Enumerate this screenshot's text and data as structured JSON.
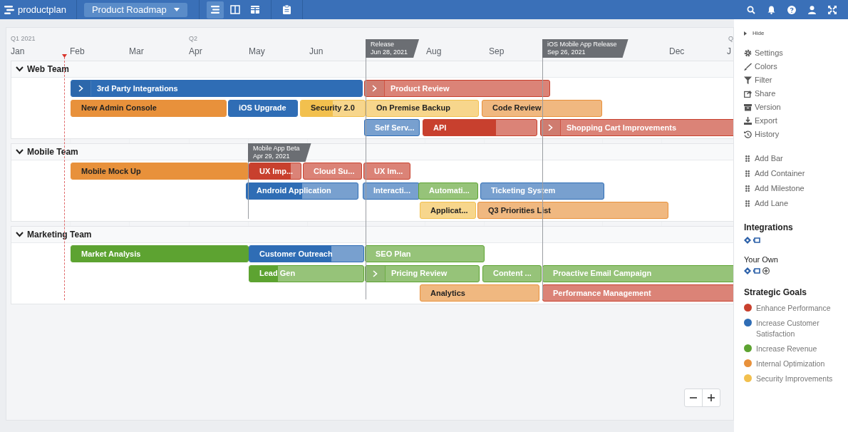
{
  "app": {
    "brand": "productplan",
    "roadmap": "Product Roadmap",
    "views": [
      {
        "kind": "list",
        "selected": true
      },
      {
        "kind": "columns",
        "selected": false
      },
      {
        "kind": "table",
        "selected": false
      }
    ]
  },
  "timeline": {
    "quarters": [
      "Q1 2021",
      "Q2",
      "Q"
    ],
    "months": [
      "Jan",
      "Feb",
      "Mar",
      "Apr",
      "May",
      "Jun",
      "Aug",
      "Sep",
      "Dec",
      "J"
    ],
    "milestones": [
      {
        "title": "Release",
        "date": "Jun 28, 2021"
      },
      {
        "title": "iOS Mobile App Release",
        "date": "Sep 26, 2021"
      },
      {
        "title": "Mobile App Beta",
        "date": "Apr 29, 2021"
      }
    ],
    "lanes": [
      {
        "name": "Web Team",
        "expanded": true,
        "rows": [
          {
            "bars": [
              {
                "label": "3rd Party Integrations",
                "kind": "container",
                "color": "#2f6db5",
                "level": 1
              },
              {
                "label": "Product Review",
                "kind": "container",
                "color": "#c8402e",
                "level": 0
              }
            ]
          },
          {
            "bars": [
              {
                "label": "New Admin Console",
                "kind": "bar",
                "color": "#e8913b",
                "level": 1
              },
              {
                "label": "iOS Upgrade",
                "kind": "bar",
                "color": "#2f6db5",
                "level": 1
              },
              {
                "label": "Security 2.0",
                "kind": "bar",
                "color": "#f2c04e",
                "level": 0.5
              },
              {
                "label": "On Premise Backup",
                "kind": "bar",
                "color": "#f2c04e",
                "level": 0
              },
              {
                "label": "Code Review",
                "kind": "bar",
                "color": "#e8913b",
                "level": 0
              }
            ]
          },
          {
            "bars": [
              {
                "label": "Self Serv...",
                "kind": "bar",
                "color": "#2f6db5",
                "level": 0
              },
              {
                "label": "API",
                "kind": "bar",
                "color": "#c8402e",
                "level": 0.64
              },
              {
                "label": "Shopping Cart Improvements",
                "kind": "container",
                "color": "#c8402e",
                "level": 0
              }
            ]
          }
        ]
      },
      {
        "name": "Mobile Team",
        "expanded": true,
        "rows": [
          {
            "bars": [
              {
                "label": "Mobile Mock Up",
                "kind": "bar",
                "color": "#e8913b",
                "level": 1
              },
              {
                "label": "UX Imp...",
                "kind": "bar",
                "color": "#c8402e",
                "level": 0.8
              },
              {
                "label": "Cloud Su...",
                "kind": "bar",
                "color": "#c8402e",
                "level": 0
              },
              {
                "label": "UX Im...",
                "kind": "bar",
                "color": "#c8402e",
                "level": 0
              }
            ]
          },
          {
            "bars": [
              {
                "label": "Android Application",
                "kind": "bar",
                "color": "#2f6db5",
                "level": 0.5
              },
              {
                "label": "Interacti...",
                "kind": "bar",
                "color": "#2f6db5",
                "level": 0
              },
              {
                "label": "Automati...",
                "kind": "bar",
                "color": "#5da331",
                "level": 0
              },
              {
                "label": "Ticketing System",
                "kind": "bar",
                "color": "#2f6db5",
                "level": 0
              }
            ]
          },
          {
            "bars": [
              {
                "label": "Applicat...",
                "kind": "bar",
                "color": "#f2c04e",
                "level": 0
              },
              {
                "label": "Q3 Priorities List",
                "kind": "bar",
                "color": "#e8913b",
                "level": 0
              }
            ]
          }
        ]
      },
      {
        "name": "Marketing Team",
        "expanded": true,
        "rows": [
          {
            "bars": [
              {
                "label": "Market Analysis",
                "kind": "bar",
                "color": "#5da331",
                "level": 1
              },
              {
                "label": "Customer Outreach",
                "kind": "bar",
                "color": "#2f6db5",
                "level": 0.72
              },
              {
                "label": "SEO Plan",
                "kind": "bar",
                "color": "#5da331",
                "level": 0
              }
            ]
          },
          {
            "bars": [
              {
                "label": "Lead Gen",
                "kind": "bar",
                "color": "#5da331",
                "level": 0.25
              },
              {
                "label": "Pricing Review",
                "kind": "container",
                "color": "#5da331",
                "level": 0
              },
              {
                "label": "Content ...",
                "kind": "bar",
                "color": "#5da331",
                "level": 0
              },
              {
                "label": "Proactive Email Campaign",
                "kind": "bar",
                "color": "#5da331",
                "level": 0
              }
            ]
          },
          {
            "bars": [
              {
                "label": "Analytics",
                "kind": "bar",
                "color": "#e8913b",
                "level": 0
              },
              {
                "label": "Performance Management",
                "kind": "bar",
                "color": "#c8402e",
                "level": 0
              }
            ]
          }
        ]
      }
    ]
  },
  "sidebar": {
    "hide": "Hide",
    "menu": [
      {
        "kind": "settings",
        "label": "Settings"
      },
      {
        "kind": "colors",
        "label": "Colors"
      },
      {
        "kind": "filter",
        "label": "Filter"
      },
      {
        "kind": "share",
        "label": "Share"
      },
      {
        "kind": "version",
        "label": "Version"
      },
      {
        "kind": "export",
        "label": "Export"
      },
      {
        "kind": "history",
        "label": "History"
      }
    ],
    "add": [
      "Add Bar",
      "Add Container",
      "Add Milestone",
      "Add Lane"
    ],
    "integrations": {
      "title": "Integrations"
    },
    "your_own": {
      "title": "Your Own"
    },
    "goals_title": "Strategic Goals",
    "goals": [
      {
        "label": "Enhance Performance",
        "color": "#c8402e"
      },
      {
        "label": "Increase Customer Satisfaction",
        "color": "#2f6db5"
      },
      {
        "label": "Increase Revenue",
        "color": "#5da331"
      },
      {
        "label": "Internal Optimization",
        "color": "#e8913b"
      },
      {
        "label": "Security Improvements",
        "color": "#f2c04e"
      }
    ]
  }
}
